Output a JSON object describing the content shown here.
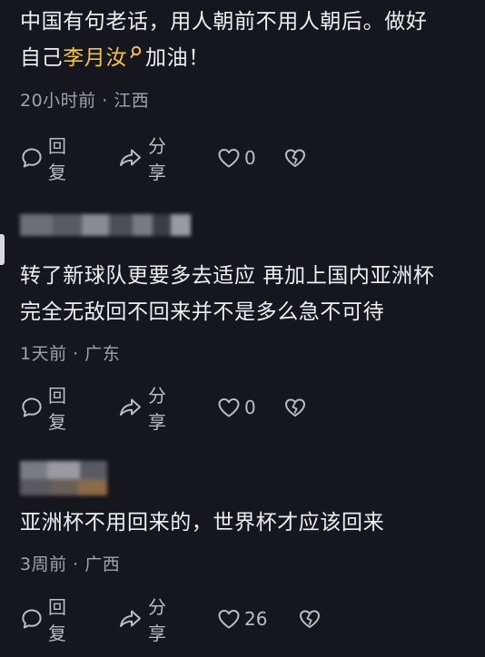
{
  "comments": [
    {
      "text_line1": "中国有句老话，用人朝前不用人朝后。做好",
      "text_before_mention": "自己",
      "mention": "李月汝",
      "text_after_mention": "加油！",
      "meta": "20小时前 · 江西",
      "actions": {
        "reply": "回复",
        "share": "分享",
        "likes": "0"
      }
    },
    {
      "text_line1": "转了新球队更要多去适应 再加上国内亚洲杯",
      "text_line2": "完全无敌回不回来并不是多么急不可待",
      "meta": "1天前 · 广东",
      "actions": {
        "reply": "回复",
        "share": "分享",
        "likes": "0"
      }
    },
    {
      "text_line1": "亚洲杯不用回来的，世界杯才应该回来",
      "meta": "3周前 · 广西",
      "actions": {
        "reply": "回复",
        "share": "分享",
        "likes": "26"
      }
    }
  ],
  "colors": {
    "background": "#16161e",
    "mention": "#f1c24a",
    "meta": "#a2a1ac"
  }
}
